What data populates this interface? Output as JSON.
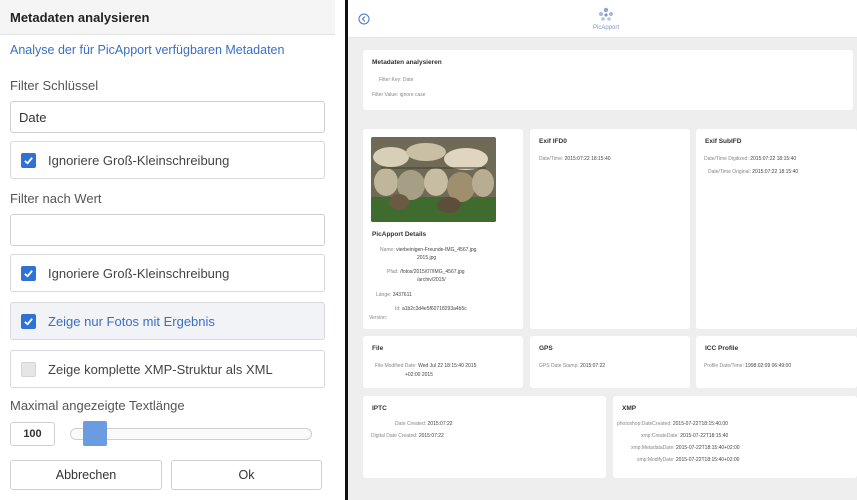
{
  "dialog": {
    "title": "Metadaten analysieren",
    "subtitle": "Analyse der für PicApport verfügbaren Metadaten",
    "filter_key_label": "Filter Schlüssel",
    "filter_key_value": "Date",
    "filter_key_ignore_case": {
      "label": "Ignoriere Groß-Kleinschreibung",
      "checked": true
    },
    "filter_value_label": "Filter nach Wert",
    "filter_value_value": "",
    "filter_value_ignore_case": {
      "label": "Ignoriere Groß-Kleinschreibung",
      "checked": true
    },
    "only_results": {
      "label": "Zeige nur Fotos mit Ergebnis",
      "checked": true
    },
    "full_xmp": {
      "label": "Zeige komplette XMP-Struktur als XML",
      "checked": false
    },
    "max_text_length_label": "Maximal angezeigte Textlänge",
    "max_text_length_value": "100",
    "slider_fraction": 0.06,
    "cancel_label": "Abbrechen",
    "ok_label": "Ok"
  },
  "colors": {
    "accent": "#2f72d6",
    "link": "#3a6fc4",
    "logo": "#7f95c4",
    "divider": "#111111"
  },
  "app": {
    "back_icon": "back-arrow-icon",
    "logo_text": "PicApport",
    "summary": {
      "title": "Metadaten analysieren",
      "line1": "Filter Key: Date",
      "line2": "Filter Value: ignore case"
    },
    "photo_card": {
      "title": "PicApport Details",
      "rows": [
        {
          "k": "Name:",
          "v": "vierbeinigen-Freunde-IMG_4567.jpg"
        },
        {
          "k": "",
          "v": "2015.jpg"
        },
        {
          "k": "Pfad:",
          "v": "/fotos/2015/07/IMG_4567.jpg"
        },
        {
          "k": "",
          "v": "/archiv/2015/"
        },
        {
          "k": "Länge:",
          "v": "3437611"
        },
        {
          "k": "Id:",
          "v": "a1b2c3d4e5f60718293a4b5c"
        },
        {
          "k": "Version:",
          "v": ""
        }
      ]
    },
    "exif_ifd0": {
      "title": "Exif IFD0",
      "rows": [
        {
          "k": "Date/Time:",
          "v": "2015:07:22 18:15:40"
        }
      ]
    },
    "exif_subifd": {
      "title": "Exif SubIFD",
      "rows": [
        {
          "k": "Date/Time Digitized:",
          "v": "2015:07:22 18:15:40"
        },
        {
          "k": "Date/Time Original:",
          "v": "2015:07:22 18:15:40"
        }
      ]
    },
    "file_card": {
      "title": "File",
      "rows": [
        {
          "k": "File Modified Date:",
          "v": "Wed Jul 22 18:15:40 2015"
        },
        {
          "k": "",
          "v": "+02:00 2015"
        }
      ]
    },
    "gps_card": {
      "title": "GPS",
      "rows": [
        {
          "k": "GPS Date Stamp:",
          "v": "2015:07:22"
        }
      ]
    },
    "icc_card": {
      "title": "ICC Profile",
      "rows": [
        {
          "k": "Profile Date/Time:",
          "v": "1998:02:09 06:49:00"
        }
      ]
    },
    "iptc_card": {
      "title": "IPTC",
      "rows": [
        {
          "k": "Date Created:",
          "v": "2015:07:22"
        },
        {
          "k": "Digital Date Created:",
          "v": "2015:07:22"
        }
      ]
    },
    "xmp_card": {
      "title": "XMP",
      "rows": [
        {
          "k": "photoshop:DateCreated:",
          "v": "2015-07-22T18:15:40.00"
        },
        {
          "k": "xmp:CreateDate:",
          "v": "2015-07-22T18:15:40"
        },
        {
          "k": "xmp:MetadataDate:",
          "v": "2015-07-22T18:15:40+02:00"
        },
        {
          "k": "xmp:ModifyDate:",
          "v": "2015-07-22T18:15:40+02:00"
        }
      ]
    }
  }
}
